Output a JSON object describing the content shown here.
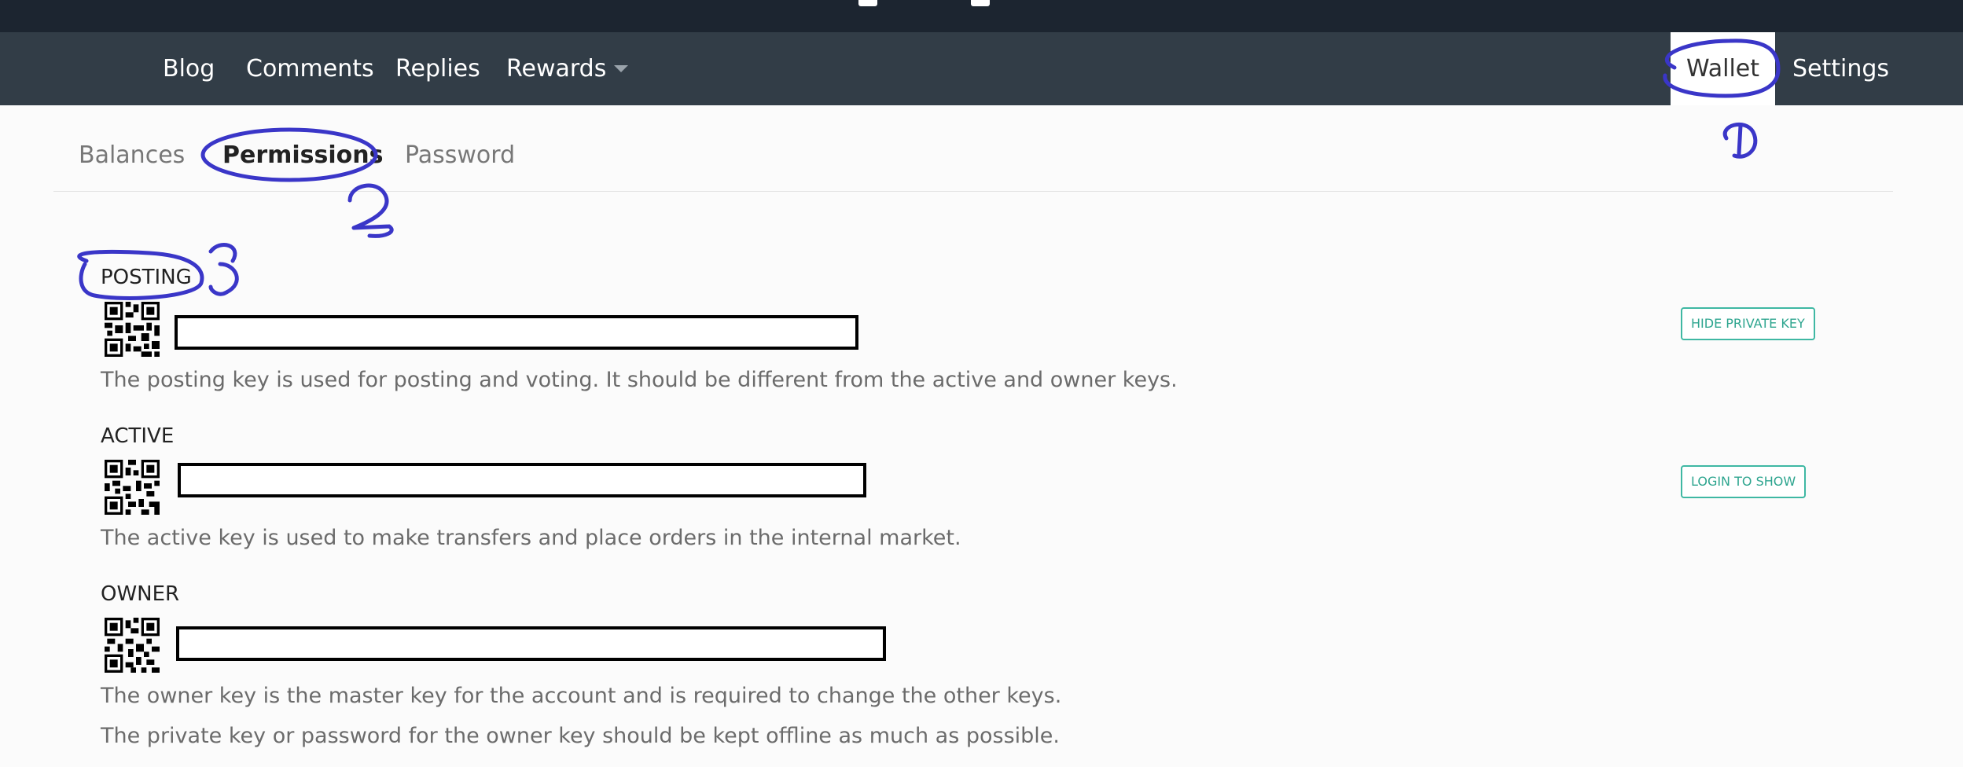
{
  "nav": {
    "items": [
      {
        "label": "Blog"
      },
      {
        "label": "Comments"
      },
      {
        "label": "Replies"
      },
      {
        "label": "Rewards"
      }
    ],
    "right_items": [
      {
        "label": "Wallet",
        "active": true
      },
      {
        "label": "Settings"
      }
    ]
  },
  "subnav": {
    "tabs": [
      {
        "label": "Balances"
      },
      {
        "label": "Permissions",
        "active": true
      },
      {
        "label": "Password"
      }
    ]
  },
  "keys": [
    {
      "label": "POSTING",
      "description": "The posting key is used for posting and voting. It should be different from the active and owner keys.",
      "button": "HIDE PRIVATE KEY"
    },
    {
      "label": "ACTIVE",
      "description": "The active key is used to make transfers and place orders in the internal market.",
      "button": "LOGIN TO SHOW"
    },
    {
      "label": "OWNER",
      "description": "The owner key is the master key for the account and is required to change the other keys.",
      "description2": "The private key or password for the owner key should be kept offline as much as possible."
    }
  ],
  "colors": {
    "topbar": "#1c2530",
    "navbar": "#323d47",
    "accent": "#3fb8a3",
    "annotation": "#3a36c8"
  },
  "icons": {
    "qr": "qr-code-icon",
    "caret": "caret-down-icon"
  }
}
